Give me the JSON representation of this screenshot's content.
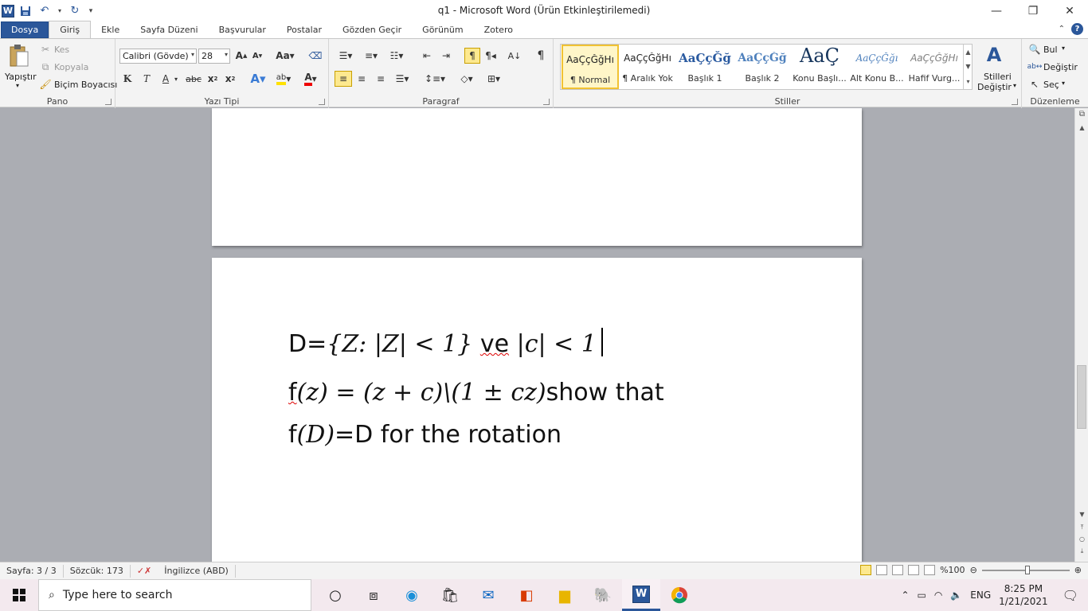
{
  "window": {
    "title": "q1  -  Microsoft Word (Ürün Etkinleştirilemedi)"
  },
  "tabs": [
    {
      "label": "Dosya"
    },
    {
      "label": "Giriş"
    },
    {
      "label": "Ekle"
    },
    {
      "label": "Sayfa Düzeni"
    },
    {
      "label": "Başvurular"
    },
    {
      "label": "Postalar"
    },
    {
      "label": "Gözden Geçir"
    },
    {
      "label": "Görünüm"
    },
    {
      "label": "Zotero"
    }
  ],
  "clipboard": {
    "paste": "Yapıştır",
    "cut": "Kes",
    "copy": "Kopyala",
    "format_painter": "Biçim Boyacısı",
    "group": "Pano"
  },
  "font": {
    "name": "Calibri (Gövde)",
    "size": "28",
    "group": "Yazı Tipi"
  },
  "paragraph": {
    "group": "Paragraf"
  },
  "styles": {
    "group": "Stiller",
    "items": [
      {
        "preview": "AaÇçĞğHı",
        "name": "¶ Normal"
      },
      {
        "preview": "AaÇçĞğHı",
        "name": "¶ Aralık Yok"
      },
      {
        "preview": "AaÇçĞğ",
        "name": "Başlık 1"
      },
      {
        "preview": "AaÇçĞğ",
        "name": "Başlık 2"
      },
      {
        "preview": "AaÇ",
        "name": "Konu Başlı..."
      },
      {
        "preview": "AaÇçĞğı",
        "name": "Alt Konu B..."
      },
      {
        "preview": "AaÇçĞğHı",
        "name": "Hafif Vurg..."
      }
    ],
    "change_label_1": "Stilleri",
    "change_label_2": "Değiştir"
  },
  "editing": {
    "find": "Bul",
    "replace": "Değiştir",
    "select": "Seç",
    "group": "Düzenleme"
  },
  "document": {
    "line1": {
      "prefix": "D=",
      "math": "{Z: |Z| < 1}",
      "ve": "ve",
      "math2": "|c| < 1"
    },
    "line2": {
      "prefix": "f",
      "math": "(z) = (z + c)\\(1 ± cz)",
      "suffix": "show that"
    },
    "line3": {
      "prefix": "f",
      "math": "(D)",
      "suffix": "=D for the rotation"
    }
  },
  "status": {
    "page": "Sayfa: 3 / 3",
    "words": "Sözcük: 173",
    "language": "İngilizce (ABD)",
    "zoom": "%100"
  },
  "taskbar": {
    "search_placeholder": "Type here to search",
    "lang": "ENG",
    "time": "8:25 PM",
    "date": "1/21/2021"
  }
}
